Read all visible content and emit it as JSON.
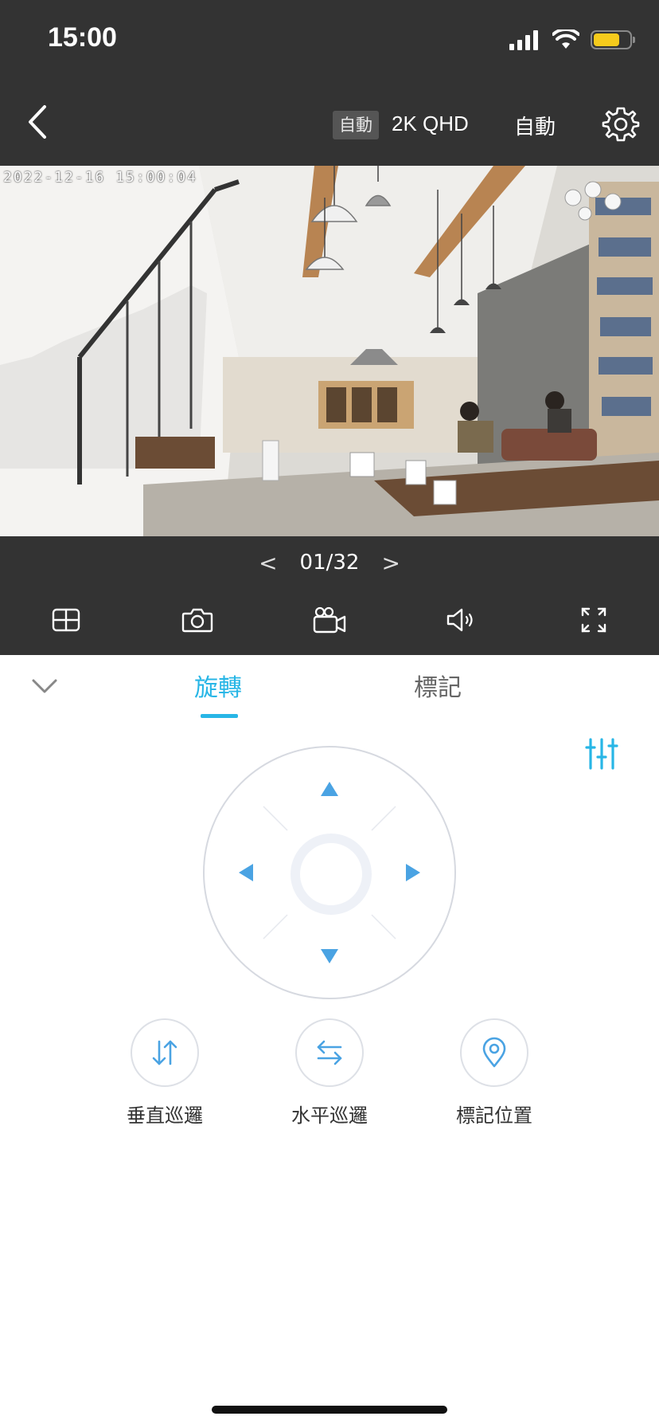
{
  "status_bar": {
    "time": "15:00",
    "signal_icon": "cellular-signal-icon",
    "wifi_icon": "wifi-icon",
    "battery_icon": "battery-icon",
    "battery_level": 0.75,
    "battery_color": "#f6cb1c"
  },
  "header": {
    "back_icon": "chevron-left-icon",
    "auto_badge": "自動",
    "quality": "2K QHD",
    "mode": "自動",
    "settings_icon": "gear-icon"
  },
  "video": {
    "timestamp": "2022-12-16 15:00:04"
  },
  "pager": {
    "prev": "<",
    "label": "01/32",
    "next": ">"
  },
  "toolbar": {
    "icons": [
      "grid-layout-icon",
      "camera-icon",
      "video-record-icon",
      "speaker-icon",
      "fullscreen-icon"
    ]
  },
  "panel": {
    "collapse_icon": "chevron-down-icon",
    "tabs": [
      {
        "label": "旋轉",
        "active": true
      },
      {
        "label": "標記",
        "active": false
      }
    ],
    "adjust_icon": "sliders-icon",
    "accent_color": "#28b6e6"
  },
  "dpad": {
    "up_icon": "arrow-up-icon",
    "down_icon": "arrow-down-icon",
    "left_icon": "arrow-left-icon",
    "right_icon": "arrow-right-icon"
  },
  "actions": [
    {
      "label": "垂直巡邏",
      "icon": "vertical-patrol-icon"
    },
    {
      "label": "水平巡邏",
      "icon": "horizontal-patrol-icon"
    },
    {
      "label": "標記位置",
      "icon": "location-pin-icon"
    }
  ]
}
